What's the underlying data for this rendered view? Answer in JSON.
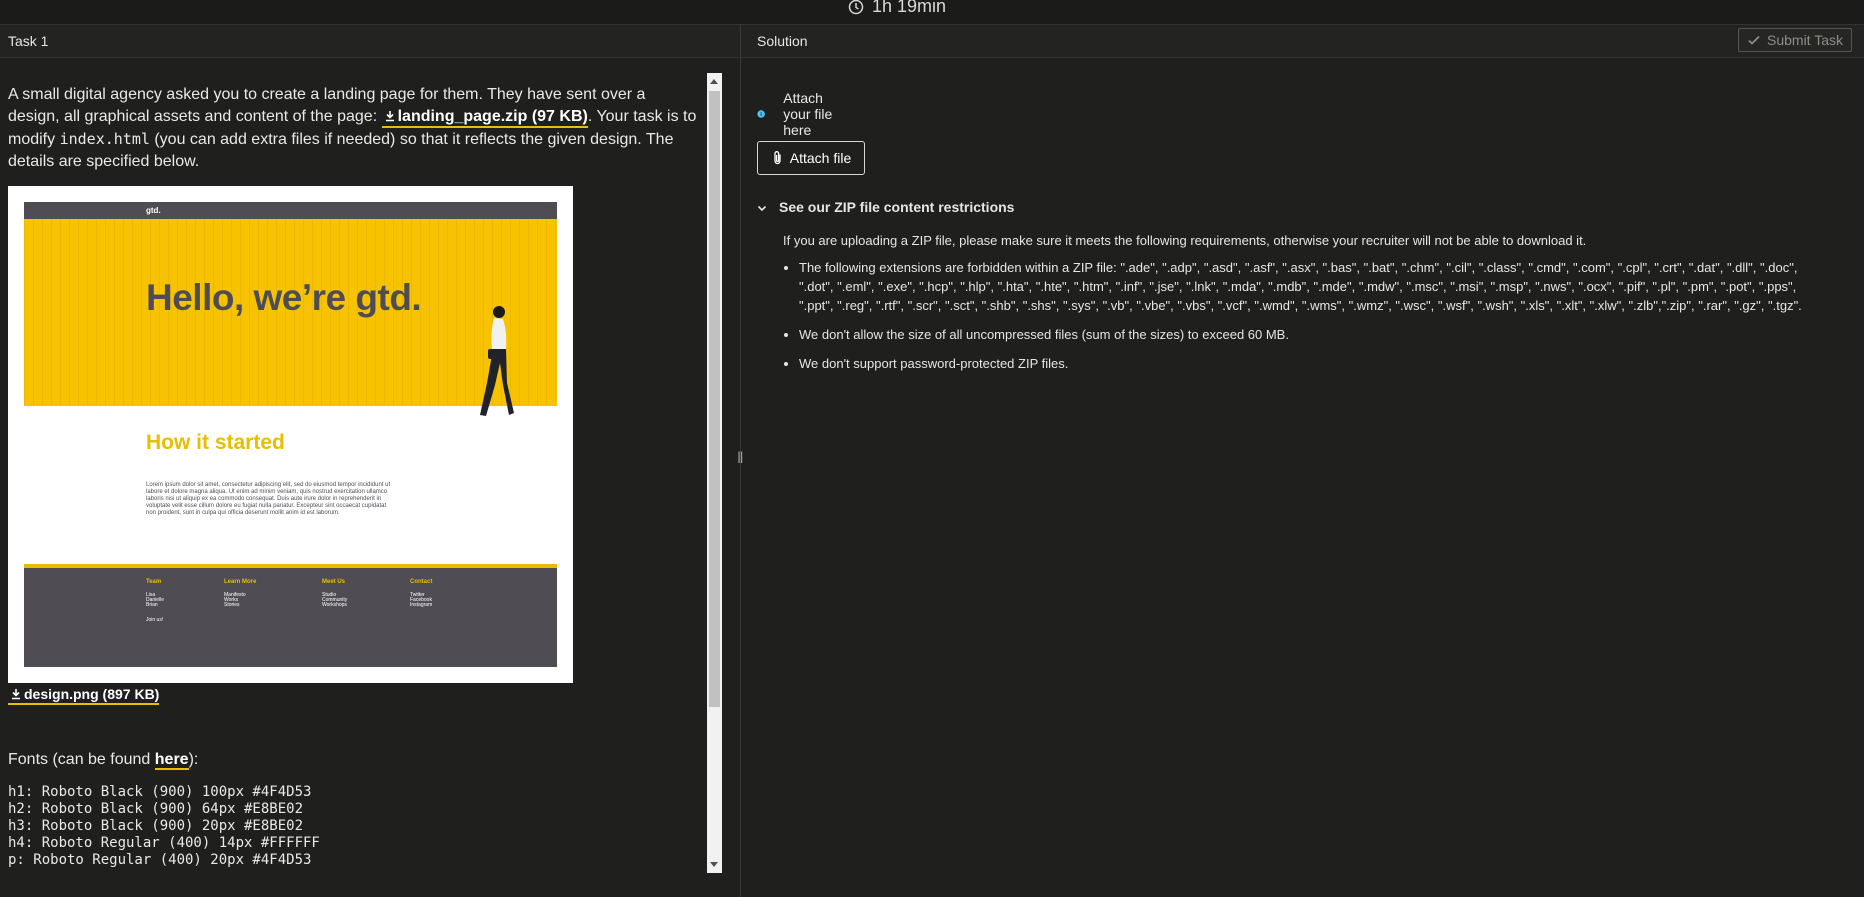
{
  "timer": {
    "text": "1h 19min"
  },
  "left_panel": {
    "title": "Task 1",
    "intro_part1": "A small digital agency asked you to create a landing page for them. They have sent over a design, all graphical assets and content of the page:",
    "zip_link": "landing_page.zip (97 KB)",
    "intro_part2": ". Your task is to modify",
    "code_file": "index.html",
    "intro_part3": "(you can add extra files if needed) so that it reflects the given design. The details are specified below.",
    "design_link": "design.png (897 KB)",
    "fonts_prefix": "Fonts (can be found",
    "fonts_link": "here",
    "fonts_suffix": "):",
    "font_specs": [
      "h1: Roboto Black (900) 100px #4F4D53",
      "h2: Roboto Black (900) 64px #E8BE02",
      "h3: Roboto Black (900) 20px #E8BE02",
      "h4: Roboto Regular (400) 14px #FFFFFF",
      "p: Roboto Regular (400) 20px #4F4D53"
    ]
  },
  "design_mockup": {
    "nav_logo": "gtd.",
    "hero_title": "Hello, we’re gtd.",
    "section_title": "How it started",
    "paragraph": "Lorem ipsum dolor sit amet, consectetur adipiscing elit, sed do eiusmod tempor incididunt ut labore et dolore magna aliqua. Ut enim ad minim veniam, quis nostrud exercitation ullamco laboris nisi ut aliquip ex ea commodo consequat. Duis aute irure dolor in reprehenderit in voluptate velit esse cillum dolore eu fugiat nulla pariatur. Excepteur sint occaecat cupidatat non proident, sunt in culpa qui officia deserunt mollit anim id est laborum.",
    "footer": {
      "team": {
        "heading": "Team",
        "items": [
          "Lisa",
          "Danielle",
          "Brian"
        ],
        "extra": "Join us!"
      },
      "learn": {
        "heading": "Learn More",
        "items": [
          "Manifesto",
          "Works",
          "Stories"
        ]
      },
      "meet": {
        "heading": "Meet Us",
        "items": [
          "Studio",
          "Community",
          "Workshops"
        ]
      },
      "contact": {
        "heading": "Contact",
        "items": [
          "Twitter",
          "Facebook",
          "Instagram"
        ]
      }
    },
    "colors": {
      "dark": "#4F4D53",
      "yellow": "#E8BE02",
      "hero_bg": "#F7C300"
    }
  },
  "right_panel": {
    "title": "Solution",
    "submit_label": "Submit Task",
    "attach_hint": "Attach your file here",
    "attach_button": "Attach file",
    "restrictions_title": "See our ZIP file content restrictions",
    "restrictions_intro": "If you are uploading a ZIP file, please make sure it meets the following requirements, otherwise your recruiter will not be able to download it.",
    "restrictions": [
      "The following extensions are forbidden within a ZIP file: \".ade\", \".adp\", \".asd\", \".asf\", \".asx\", \".bas\", \".bat\", \".chm\", \".cil\", \".class\", \".cmd\", \".com\", \".cpl\", \".crt\", \".dat\", \".dll\", \".doc\", \".dot\", \".eml\", \".exe\", \".hcp\", \".hlp\", \".hta\", \".hte\", \".htm\", \".inf\", \".jse\", \".lnk\", \".mda\", \".mdb\", \".mde\", \".mdw\", \".msc\", \".msi\", \".msp\", \".nws\", \".ocx\", \".pif\", \".pl\", \".pm\", \".pot\", \".pps\", \".ppt\", \".reg\", \".rtf\", \".scr\", \".sct\", \".shb\", \".shs\", \".sys\", \".vb\", \".vbe\", \".vbs\", \".vcf\", \".wmd\", \".wms\", \".wmz\", \".wsc\", \".wsf\", \".wsh\", \".xls\", \".xlt\", \".xlw\", \".zlb\",\".zip\", \".rar\", \".gz\", \".tgz\".",
      "We don't allow the size of all uncompressed files (sum of the sizes) to exceed 60 MB.",
      "We don't support password-protected ZIP files."
    ]
  },
  "icons": {
    "timer": "clock-icon",
    "download": "download-icon",
    "submit": "check-icon",
    "info": "info-icon",
    "attach": "paperclip-icon",
    "collapse": "chevron-down-icon"
  },
  "theme": {
    "background": "#1F1F1D",
    "accent": "#E8BE02",
    "info": "#4FC3F7"
  }
}
